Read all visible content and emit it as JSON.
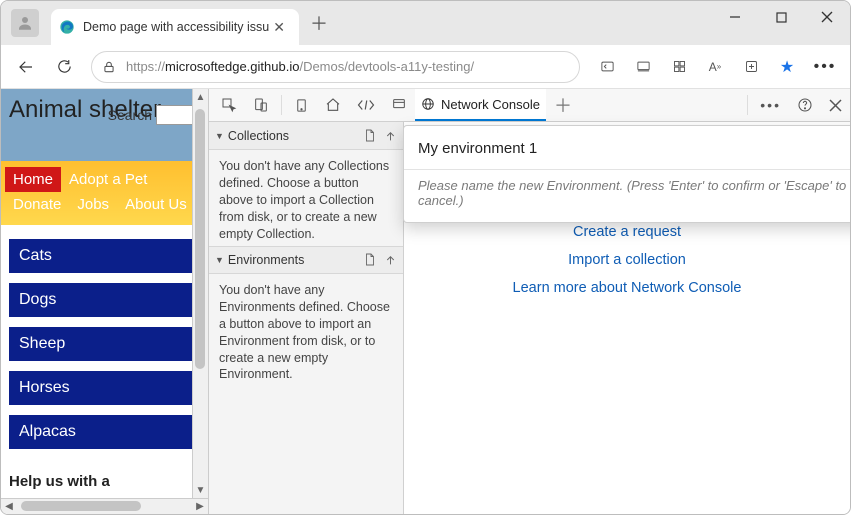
{
  "browser": {
    "tab_title": "Demo page with accessibility issu",
    "url_prefix": "https://",
    "url_host": "microsoftedge.github.io",
    "url_path": "/Demos/devtools-a11y-testing/"
  },
  "page": {
    "site_title": "Animal shelter",
    "search_label": "Search",
    "nav": {
      "home": "Home",
      "adopt": "Adopt a Pet",
      "donate": "Donate",
      "jobs": "Jobs",
      "about": "About Us"
    },
    "animals": [
      "Cats",
      "Dogs",
      "Sheep",
      "Horses",
      "Alpacas"
    ],
    "help_heading": "Help us with a"
  },
  "devtools": {
    "tabs": {
      "network_console": "Network Console"
    },
    "sidebar": {
      "collections_label": "Collections",
      "collections_empty": "You don't have any Collections defined. Choose a button above to import a Collection from disk, or to create a new empty Collection.",
      "environments_label": "Environments",
      "environments_empty": "You don't have any Environments defined. Choose a button above to import an Environment from disk, or to create a new empty Environment."
    },
    "main_links": {
      "create": "Create a request",
      "import": "Import a collection",
      "learn": "Learn more about Network Console"
    },
    "env_popup": {
      "name_value": "My environment 1",
      "hint": "Please name the new Environment. (Press 'Enter' to confirm or 'Escape' to cancel.)"
    }
  }
}
